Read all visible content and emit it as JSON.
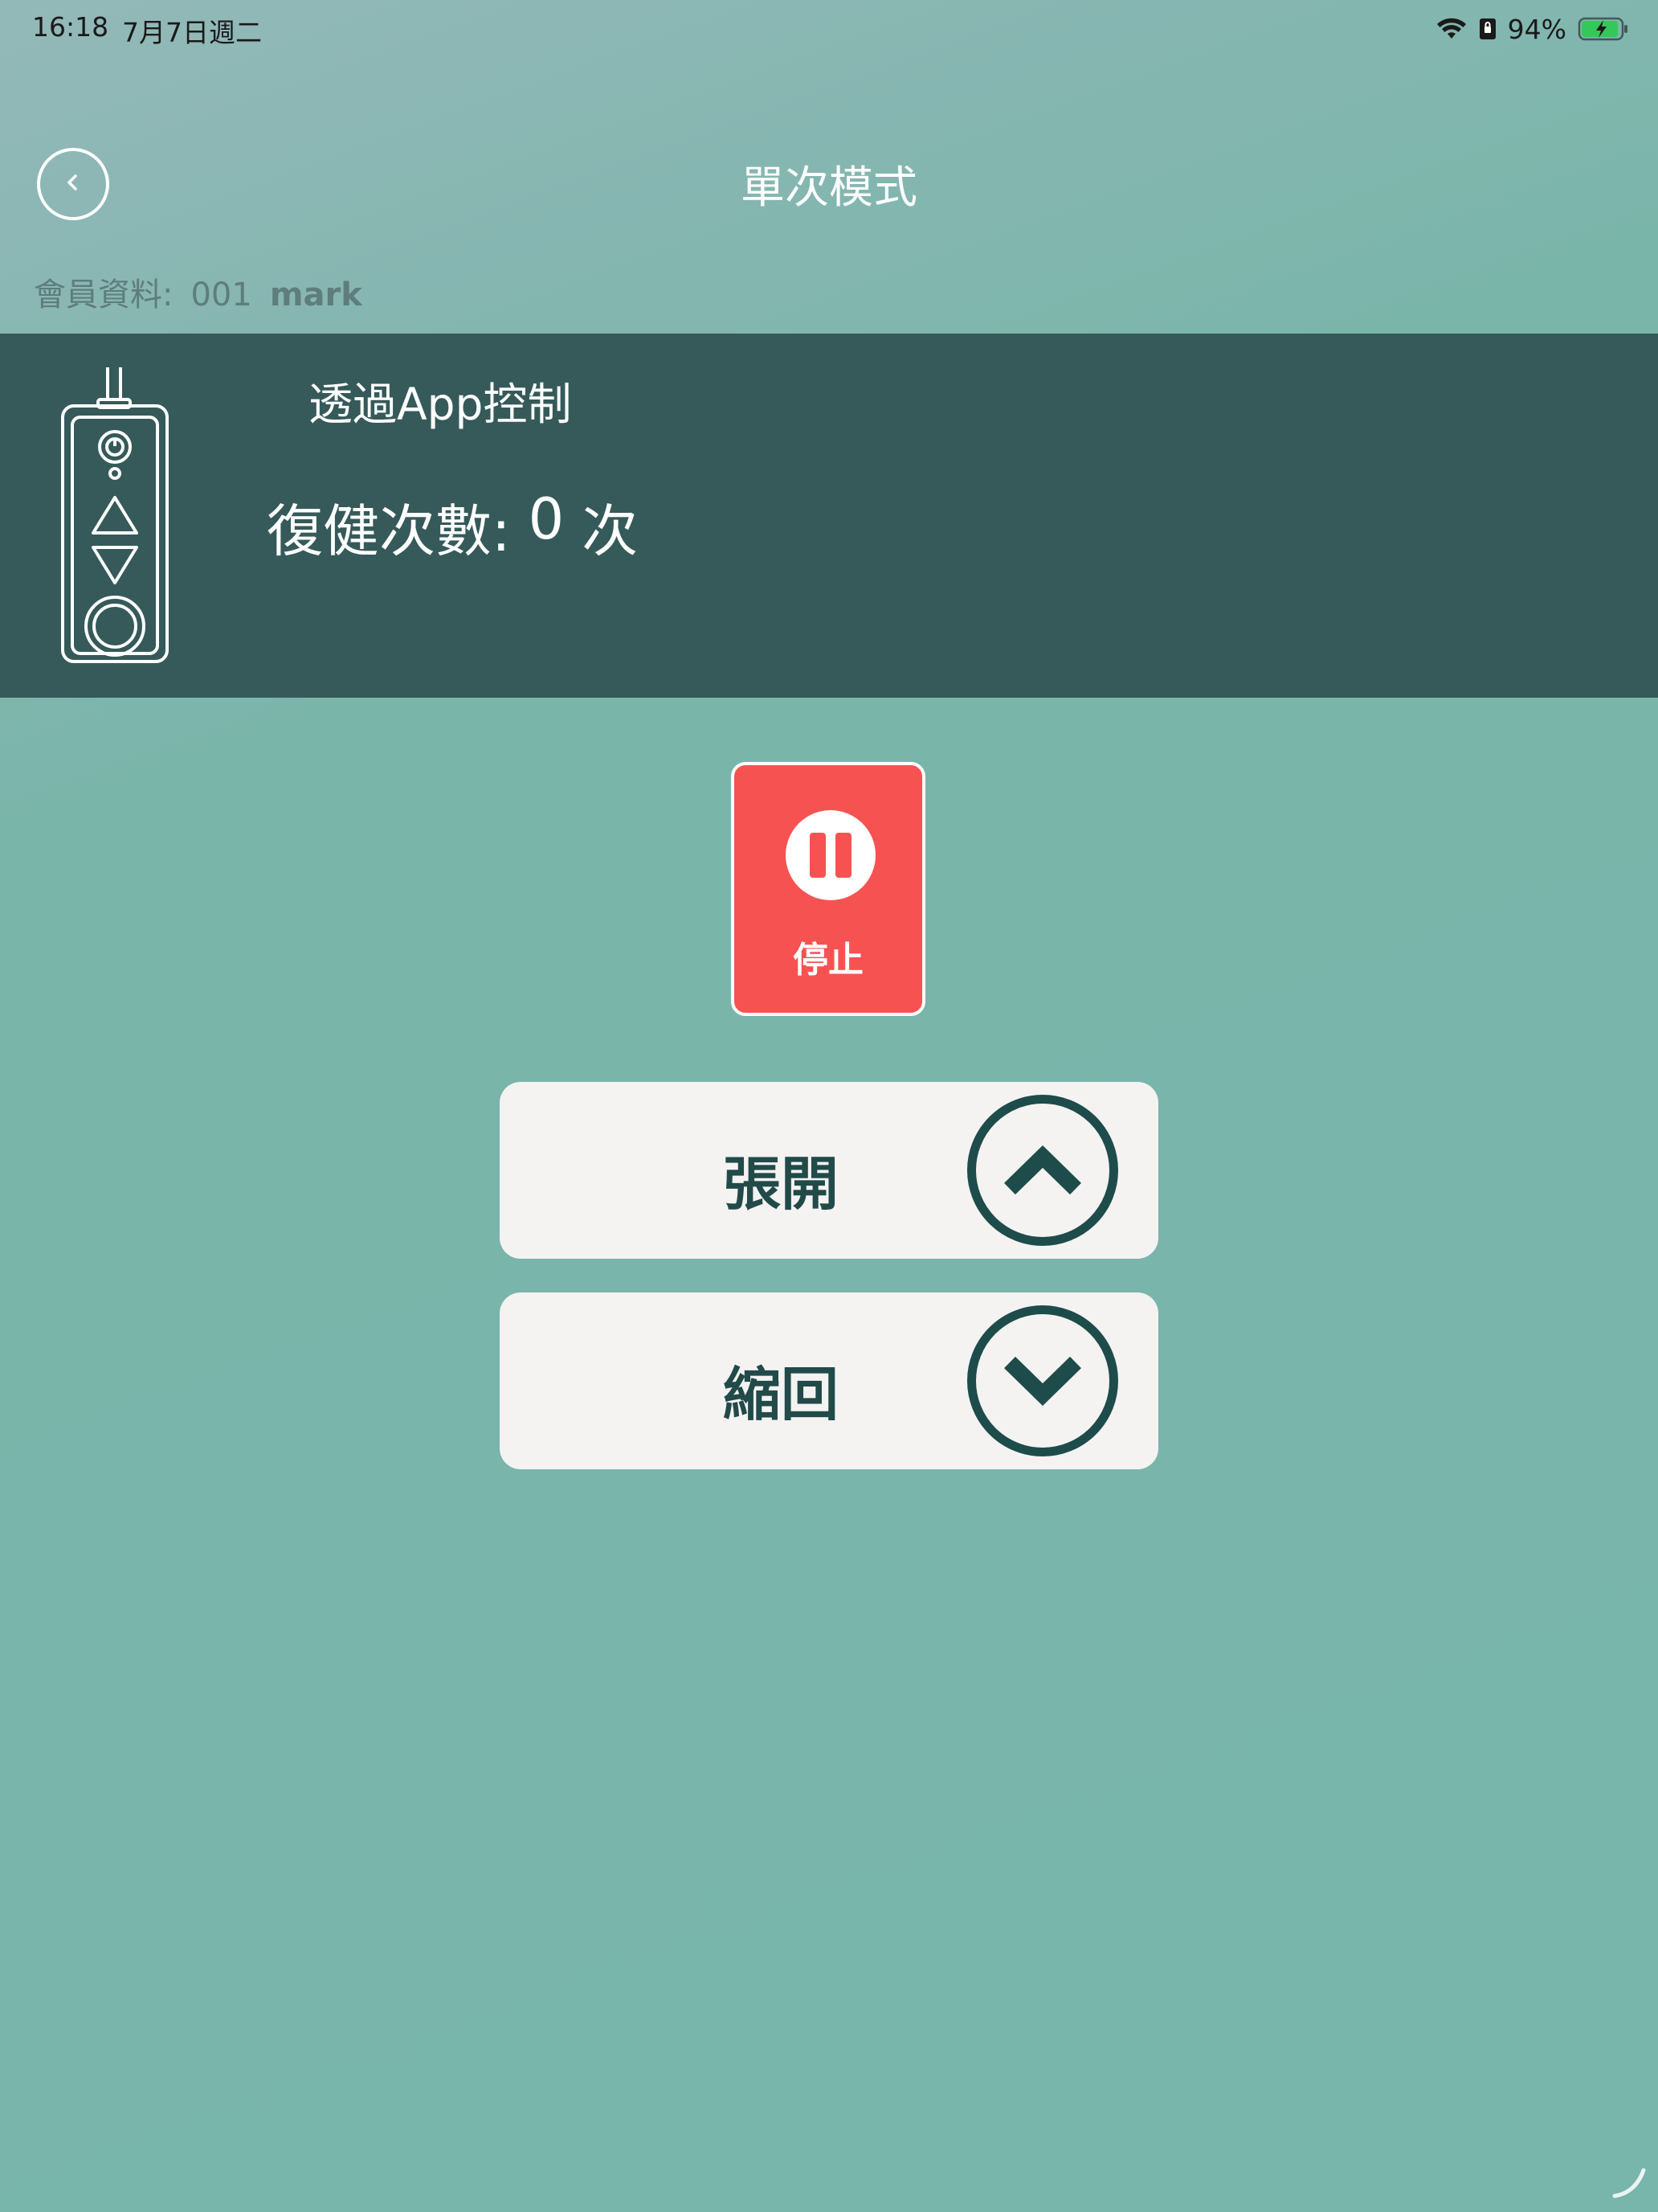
{
  "status_bar": {
    "time": "16:18",
    "date": "7月7日週二",
    "battery_percent": "94%",
    "battery_level": 0.94,
    "icons": [
      "wifi-icon",
      "lock-rotation-icon",
      "battery-charging-icon"
    ]
  },
  "header": {
    "title": "單次模式",
    "back_icon": "chevron-left-icon"
  },
  "member": {
    "label": "會員資料:",
    "id": "001",
    "name": "mark"
  },
  "info_panel": {
    "control_mode": "透過App控制",
    "count_label": "復健次數:",
    "count_value": "0",
    "count_unit": "次",
    "device_icon": "remote-control-icon"
  },
  "controls": {
    "stop_label": "停止",
    "stop_icon": "pause-icon",
    "open_label": "張開",
    "open_icon": "chevron-up-icon",
    "retract_label": "縮回",
    "retract_icon": "chevron-down-icon"
  },
  "colors": {
    "background": "#78b5aa",
    "panel": "#355a59",
    "stop": "#f75252",
    "button_bg": "#f4f3f2",
    "accent_dark": "#1d4c4b",
    "battery": "#34c759"
  }
}
